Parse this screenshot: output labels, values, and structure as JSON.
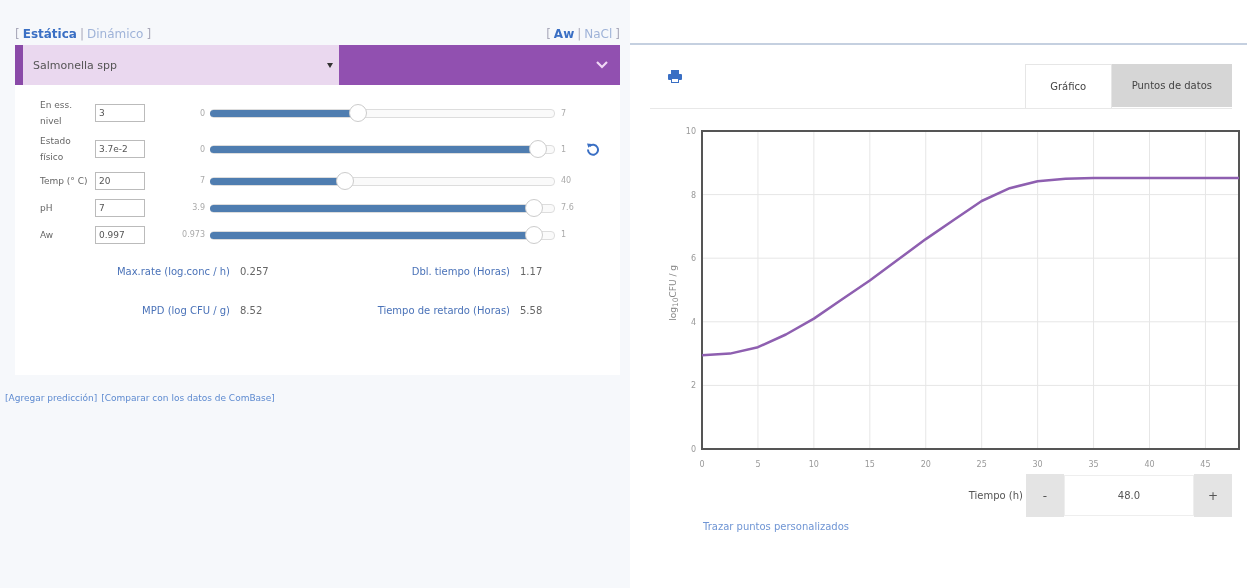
{
  "mode_switch": {
    "open_bracket": "[",
    "separator": "|",
    "close_bracket": "]",
    "tabs": [
      {
        "label": "Estática",
        "selected": true
      },
      {
        "label": "Dinámico",
        "selected": false
      }
    ]
  },
  "factor_switch": {
    "open_bracket": "[",
    "separator": "|",
    "close_bracket": "]",
    "tabs": [
      {
        "label": "Aw",
        "selected": true
      },
      {
        "label": "NaCl",
        "selected": false
      }
    ]
  },
  "organism_select": {
    "value": "Salmonella spp"
  },
  "parameters": [
    {
      "label": "En ess. nivel",
      "value": "3",
      "min": "0",
      "max": "7",
      "level": 0.43,
      "reset": false
    },
    {
      "label": "Estado físico",
      "value": "3.7e-2",
      "min": "0",
      "max": "1",
      "level": 0.95,
      "reset": true
    },
    {
      "label": "Temp (° C)",
      "value": "20",
      "min": "7",
      "max": "40",
      "level": 0.39,
      "reset": false
    },
    {
      "label": "pH",
      "value": "7",
      "min": "3.9",
      "max": "7.6",
      "level": 0.94,
      "reset": false
    },
    {
      "label": "Aw",
      "value": "0.997",
      "min": "0.973",
      "max": "1",
      "level": 0.94,
      "reset": false
    }
  ],
  "results": [
    {
      "label": "Max.rate (log.conc / h)",
      "value": "0.257"
    },
    {
      "label": "Dbl. tiempo (Horas)",
      "value": "1.17"
    },
    {
      "label": "MPD (log CFU / g)",
      "value": "8.52"
    },
    {
      "label": "Tiempo de retardo (Horas)",
      "value": "5.58"
    }
  ],
  "links": [
    "[Agregar predicción]",
    "[Comparar con los datos de ComBase]"
  ],
  "view_tabs": [
    {
      "label": "Gráfico",
      "selected": true
    },
    {
      "label": "Puntos de datos",
      "selected": false
    }
  ],
  "chart": {
    "chart_data": {
      "type": "line",
      "ylabel": "log$_{10}$CFU / g",
      "xlim": [
        0,
        48
      ],
      "ylim": [
        0,
        10
      ],
      "xticks": [
        0,
        5,
        10,
        15,
        20,
        25,
        30,
        35,
        40,
        45
      ],
      "yticks": [
        0,
        2,
        4,
        6,
        8,
        10
      ],
      "x": [
        0,
        2.5,
        5,
        7.5,
        10,
        12.5,
        15,
        17.5,
        20,
        22.5,
        25,
        27.5,
        30,
        32.5,
        35,
        40,
        45,
        48
      ],
      "grid": true,
      "series": [
        {
          "color": "#8e5fb0",
          "values": [
            2.95,
            3.0,
            3.2,
            3.6,
            4.1,
            4.7,
            5.3,
            5.95,
            6.6,
            7.2,
            7.8,
            8.2,
            8.42,
            8.5,
            8.52,
            8.52,
            8.52,
            8.52
          ]
        }
      ]
    }
  },
  "time_control": {
    "label": "Tiempo (h)",
    "decrement": "-",
    "value": "48.0",
    "increment": "+"
  },
  "custom_points_link": "Trazar puntos personalizados"
}
